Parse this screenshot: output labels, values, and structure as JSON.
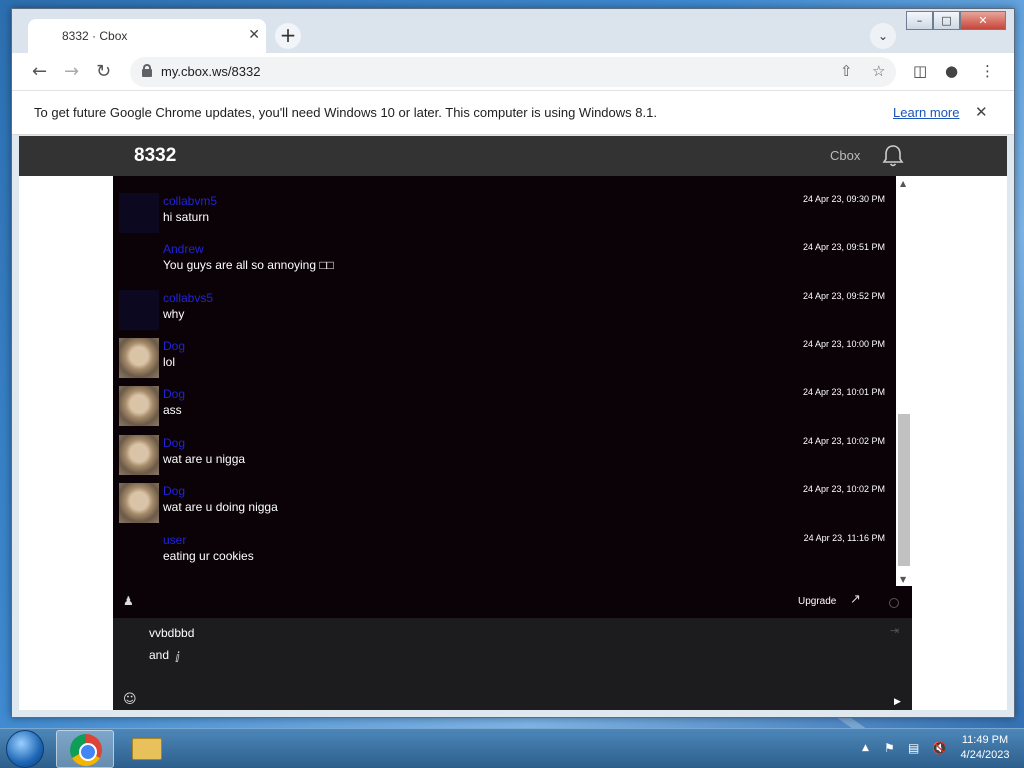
{
  "browser": {
    "tab_title": "8332 · Cbox",
    "tab_close": "✕",
    "new_tab": "+",
    "url": "my.cbox.ws/8332",
    "back": "←",
    "forward": "→",
    "reload": "↻",
    "tab_search": "⌄"
  },
  "window_controls": {
    "minimize": "–",
    "restore": "□",
    "close": "✕"
  },
  "infobar": {
    "message": "To get future Google Chrome updates, you'll need Windows 10 or later. This computer is using Windows 8.1.",
    "link": "Learn more",
    "close": "✕"
  },
  "cbox": {
    "title": "8332",
    "brand": "Cbox",
    "messages": [
      {
        "name": "collabvm5",
        "text": "hi saturn",
        "time": "24 Apr 23, 09:30 PM",
        "avatar": "dark"
      },
      {
        "name": "Andrew",
        "text": "You guys are all so annoying □□",
        "time": "24 Apr 23, 09:51 PM",
        "avatar": "none"
      },
      {
        "name": "collabvs5",
        "text": "why",
        "time": "24 Apr 23, 09:52 PM",
        "avatar": "dark"
      },
      {
        "name": "Dog",
        "text": "lol",
        "time": "24 Apr 23, 10:00 PM",
        "avatar": "dog"
      },
      {
        "name": "Dog",
        "text": "ass",
        "time": "24 Apr 23, 10:01 PM",
        "avatar": "dog"
      },
      {
        "name": "Dog",
        "text": "wat are u nigga",
        "time": "24 Apr 23, 10:02 PM",
        "avatar": "dog"
      },
      {
        "name": "Dog",
        "text": "wat are u doing nigga",
        "time": "24 Apr 23, 10:02 PM",
        "avatar": "dog"
      },
      {
        "name": "user",
        "text": "eating ur cookies",
        "time": "24 Apr 23, 11:16 PM",
        "avatar": "none"
      }
    ],
    "upgrade_label": "Upgrade",
    "compose_text": "vvbdbbd\nand"
  },
  "taskbar": {
    "time": "11:49 PM",
    "date": "4/24/2023",
    "tray_up": "▲"
  },
  "colors": {
    "cbox_header": "#333333",
    "chat_bg": "#0a0206",
    "name_link": "#2222dd",
    "compose_bg": "#1c1c1e"
  }
}
